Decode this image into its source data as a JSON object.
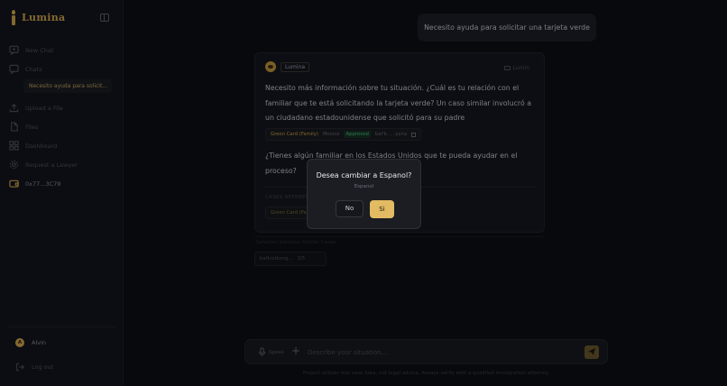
{
  "app": {
    "name": "Lumina"
  },
  "sidebar": {
    "new_chat": "New Chat",
    "chats": "Chats",
    "active_chat": "Necesito ayuda para solicit...",
    "upload": "Upload a File",
    "files": "Files",
    "dashboard": "Dashboard",
    "request_lawyer": "Request a Lawyer",
    "wallet": "0x77...3C79",
    "user_initial": "A",
    "user_name": "Alvin",
    "logout": "Log out"
  },
  "conversation": {
    "user_message": "Necesito ayuda para solicitar una tarjeta verde",
    "bot_name": "Lumina",
    "bot_tag": "Lumin",
    "response_p1": "Necesito más información sobre tu situación. ¿Cuál es tu relación con el familiar que te está solicitando la tarjeta verde? Un caso similar involucró a un ciudadano estadounidense que solicitó para su padre",
    "case_chip": {
      "type": "Green Card (Family)",
      "country": "Mexico",
      "status": "Approved",
      "id": "bafk...yuta"
    },
    "response_p2": "¿Tienes algún familiar en los Estados Unidos que te pueda ayudar en el proceso?",
    "references_label": "CASES REFERENCED",
    "reference_chip": "Green Card (Fa",
    "similar_label": "Selected previous Similar Cases",
    "similar_chip": "bafkreibxng...",
    "similar_count": "2/5"
  },
  "input": {
    "mic_label": "Speak",
    "placeholder": "Describe your situation...",
    "disclaimer": "Project utilizes real case data, not legal advice. Always verify with a qualified immigration attorney."
  },
  "modal": {
    "title": "Desea cambiar a Espanol?",
    "subtitle": "Espanol",
    "no_label": "No",
    "yes_label": "Si"
  },
  "colors": {
    "accent": "#e2bb62",
    "background": "#0d0f15",
    "sidebar": "#13161d"
  }
}
